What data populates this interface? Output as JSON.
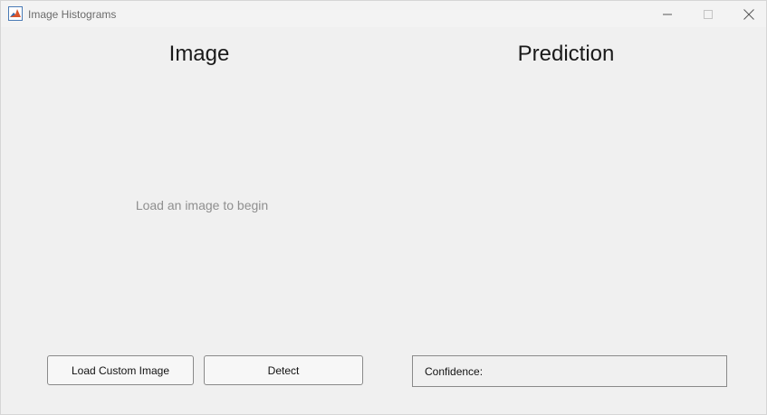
{
  "window": {
    "title": "Image Histograms",
    "icon": "matlab-icon",
    "controls": [
      "minimize-icon",
      "maximize-icon",
      "close-icon"
    ]
  },
  "panels": {
    "image_heading": "Image",
    "prediction_heading": "Prediction",
    "image_placeholder": "Load an image to begin"
  },
  "buttons": {
    "load_label": "Load Custom Image",
    "detect_label": "Detect"
  },
  "confidence": {
    "label": "Confidence:"
  }
}
